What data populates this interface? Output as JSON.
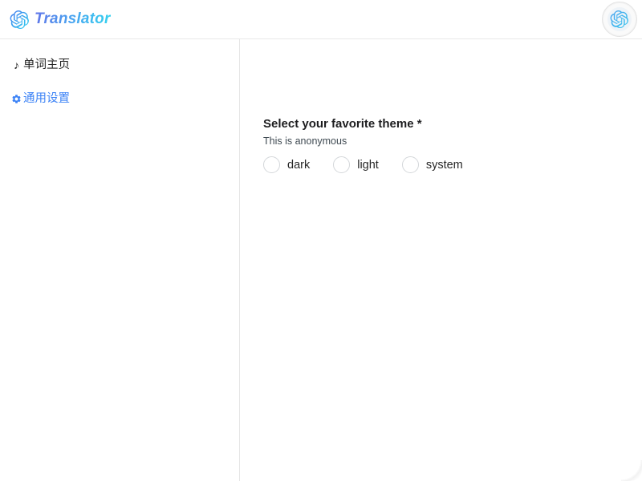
{
  "header": {
    "brand_name": "Translator",
    "brand_logo_icon": "openai-knot-icon",
    "avatar_icon": "openai-knot-icon"
  },
  "sidebar": {
    "items": [
      {
        "label": "单词主页",
        "icon": "music-note-icon",
        "active": false
      },
      {
        "label": "通用设置",
        "icon": "gear-icon",
        "active": true
      }
    ]
  },
  "main": {
    "question": {
      "title": "Select your favorite theme *",
      "subtitle": "This is anonymous",
      "options": [
        {
          "label": "dark",
          "selected": false
        },
        {
          "label": "light",
          "selected": false
        },
        {
          "label": "system",
          "selected": false
        }
      ]
    }
  },
  "colors": {
    "accent_blue": "#3b82f6",
    "brand_gradient_start": "#6274e8",
    "brand_gradient_end": "#35d3ef",
    "text_primary": "#1d1d1f",
    "border": "#e6e6e6",
    "radio_border": "#d4d7da"
  }
}
